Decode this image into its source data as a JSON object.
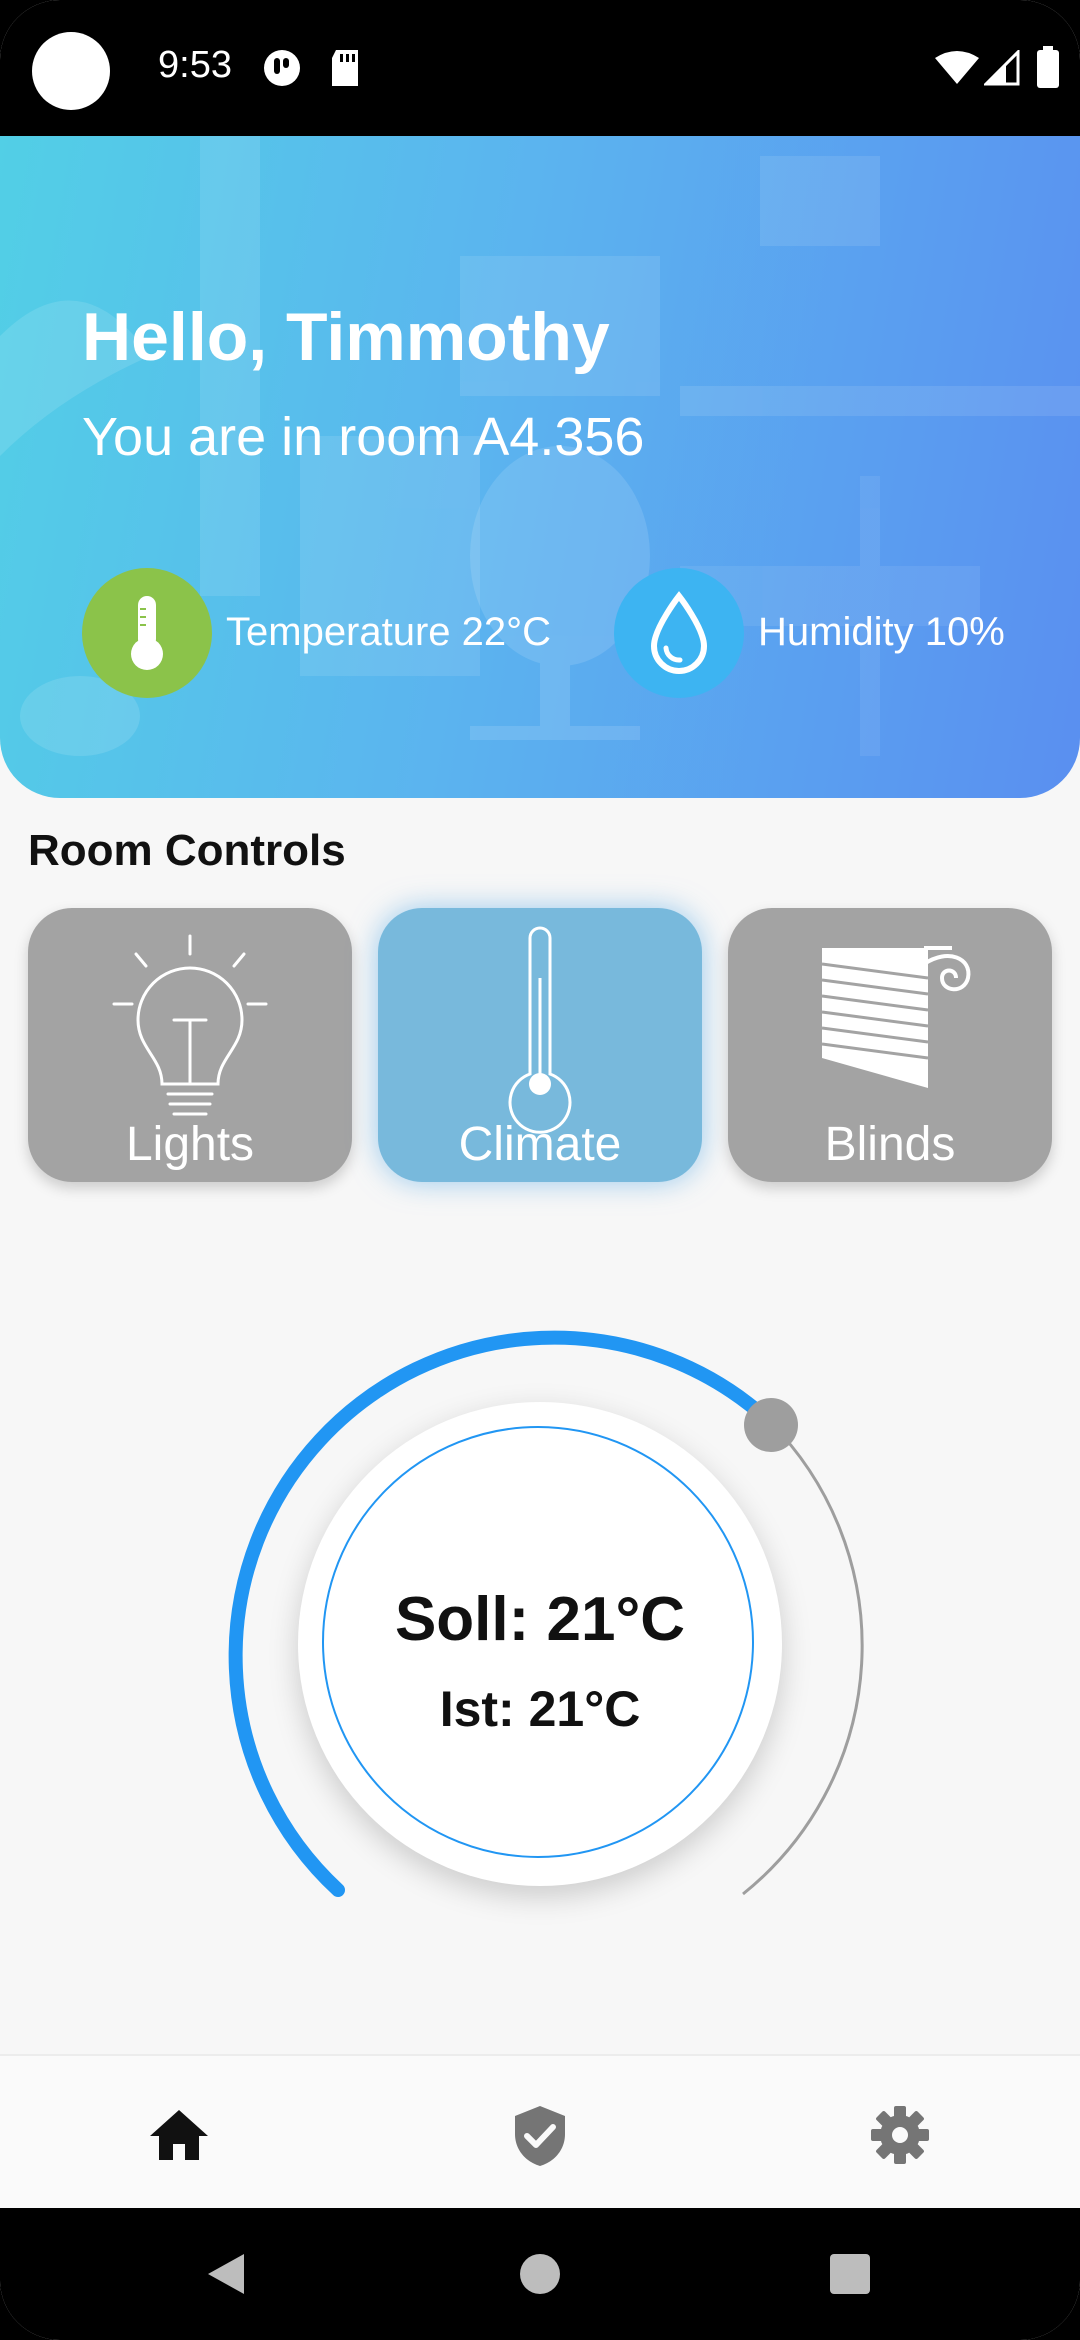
{
  "status_bar": {
    "time": "9:53"
  },
  "header": {
    "greeting": "Hello, Timmothy",
    "room": "You are in room A4.356",
    "temperature": {
      "label": "Temperature 22°C",
      "icon": "thermometer-icon",
      "color": "#8bc34a"
    },
    "humidity": {
      "label": "Humidity 10%",
      "icon": "droplet-icon",
      "color": "#3db4f2"
    }
  },
  "room_controls": {
    "title": "Room Controls",
    "cards": [
      {
        "label": "Lights",
        "icon": "lightbulb-icon",
        "active": false
      },
      {
        "label": "Climate",
        "icon": "thermometer-icon",
        "active": true
      },
      {
        "label": "Blinds",
        "icon": "blinds-icon",
        "active": false
      }
    ]
  },
  "dial": {
    "soll": "Soll: 21°C",
    "ist": "Ist: 21°C",
    "accent": "#2196f3"
  },
  "bottom_nav": {
    "items": [
      {
        "icon": "home-icon",
        "active": true
      },
      {
        "icon": "shield-check-icon",
        "active": false
      },
      {
        "icon": "gear-icon",
        "active": false
      }
    ]
  }
}
